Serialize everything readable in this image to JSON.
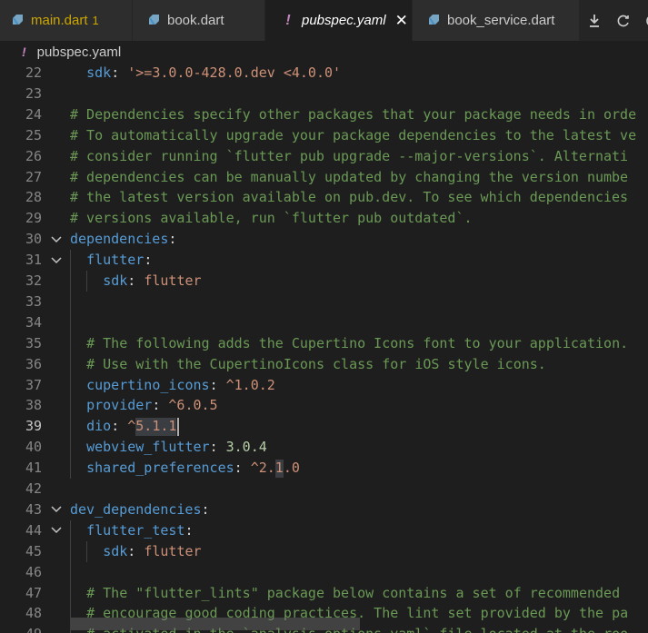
{
  "tabs": [
    {
      "label": "main.dart",
      "badge": "1",
      "icon": "dart-icon",
      "modified": true,
      "active": false
    },
    {
      "label": "book.dart",
      "icon": "dart-icon",
      "modified": false,
      "active": false
    },
    {
      "label": "pubspec.yaml",
      "icon": "yaml-exclamation-icon",
      "icon_glyph": "!",
      "modified": false,
      "active": true,
      "close": "✕"
    },
    {
      "label": "book_service.dart",
      "icon": "dart-icon",
      "modified": false,
      "active": false
    }
  ],
  "actions": [
    {
      "name": "download-icon",
      "glyph": "⤓"
    },
    {
      "name": "refresh-icon",
      "glyph": "⟳"
    },
    {
      "name": "more-icon",
      "glyph": "◴"
    }
  ],
  "breadcrumb": {
    "icon_glyph": "!",
    "label": "pubspec.yaml"
  },
  "editor": {
    "current_line": 39,
    "lines": [
      {
        "n": 22,
        "tokens": [
          [
            "k",
            "sdk"
          ],
          [
            "p",
            ": "
          ],
          [
            "s",
            "'>=3.0.0-428.0.dev <4.0.0'"
          ]
        ]
      },
      {
        "n": 23,
        "tokens": []
      },
      {
        "n": 24,
        "tokens": [
          [
            "c",
            "# Dependencies specify other packages that your package needs in orde"
          ]
        ]
      },
      {
        "n": 25,
        "tokens": [
          [
            "c",
            "# To automatically upgrade your package dependencies to the latest ve"
          ]
        ]
      },
      {
        "n": 26,
        "tokens": [
          [
            "c",
            "# consider running `flutter pub upgrade --major-versions`. Alternati"
          ]
        ]
      },
      {
        "n": 27,
        "tokens": [
          [
            "c",
            "# dependencies can be manually updated by changing the version numbe"
          ]
        ]
      },
      {
        "n": 28,
        "tokens": [
          [
            "c",
            "# the latest version available on pub.dev. To see which dependencies"
          ]
        ]
      },
      {
        "n": 29,
        "tokens": [
          [
            "c",
            "# versions available, run `flutter pub outdated`."
          ]
        ]
      },
      {
        "n": 30,
        "tokens": [
          [
            "k",
            "dependencies"
          ],
          [
            "p",
            ":"
          ]
        ]
      },
      {
        "n": 31,
        "tokens": [
          [
            "k",
            "flutter"
          ],
          [
            "p",
            ":"
          ]
        ]
      },
      {
        "n": 32,
        "tokens": [
          [
            "k",
            "sdk"
          ],
          [
            "p",
            ": "
          ],
          [
            "s",
            "flutter"
          ]
        ]
      },
      {
        "n": 33,
        "tokens": []
      },
      {
        "n": 34,
        "tokens": []
      },
      {
        "n": 35,
        "tokens": [
          [
            "c",
            "# The following adds the Cupertino Icons font to your application."
          ]
        ]
      },
      {
        "n": 36,
        "tokens": [
          [
            "c",
            "# Use with the CupertinoIcons class for iOS style icons."
          ]
        ]
      },
      {
        "n": 37,
        "tokens": [
          [
            "k",
            "cupertino_icons"
          ],
          [
            "p",
            ": "
          ],
          [
            "s",
            "^1.0.2"
          ]
        ]
      },
      {
        "n": 38,
        "tokens": [
          [
            "k",
            "provider"
          ],
          [
            "p",
            ": "
          ],
          [
            "s",
            "^6.0.5"
          ]
        ]
      },
      {
        "n": 39,
        "tokens": [
          [
            "k",
            "dio"
          ],
          [
            "p",
            ": "
          ],
          [
            "s",
            "^5.1.1"
          ]
        ]
      },
      {
        "n": 40,
        "tokens": [
          [
            "k",
            "webview_flutter"
          ],
          [
            "p",
            ": "
          ],
          [
            "n",
            "3.0.4"
          ]
        ]
      },
      {
        "n": 41,
        "tokens": [
          [
            "k",
            "shared_preferences"
          ],
          [
            "p",
            ": "
          ],
          [
            "s",
            "^2.1.0"
          ]
        ]
      },
      {
        "n": 42,
        "tokens": []
      },
      {
        "n": 43,
        "tokens": [
          [
            "k",
            "dev_dependencies"
          ],
          [
            "p",
            ":"
          ]
        ]
      },
      {
        "n": 44,
        "tokens": [
          [
            "k",
            "flutter_test"
          ],
          [
            "p",
            ":"
          ]
        ]
      },
      {
        "n": 45,
        "tokens": [
          [
            "k",
            "sdk"
          ],
          [
            "p",
            ": "
          ],
          [
            "s",
            "flutter"
          ]
        ]
      },
      {
        "n": 46,
        "tokens": []
      },
      {
        "n": 47,
        "tokens": [
          [
            "c",
            "# The \"flutter_lints\" package below contains a set of recommended"
          ]
        ]
      },
      {
        "n": 48,
        "tokens": [
          [
            "c",
            "# encourage good coding practices. The lint set provided by the pa"
          ]
        ]
      },
      {
        "n": 49,
        "tokens": [
          [
            "c",
            "# activated in the `analysis_options.yaml` file located at the roo"
          ]
        ]
      }
    ]
  }
}
